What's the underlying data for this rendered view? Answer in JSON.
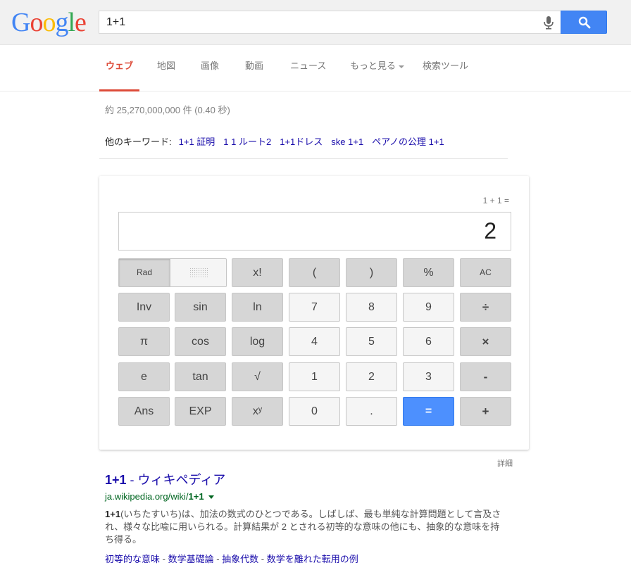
{
  "logo": {
    "letters": [
      "G",
      "o",
      "o",
      "g",
      "l",
      "e"
    ],
    "colors": [
      "#4285f4",
      "#ea4335",
      "#fbbc05",
      "#4285f4",
      "#34a853",
      "#ea4335"
    ]
  },
  "search": {
    "query": "1+1",
    "mic_icon": "microphone-icon",
    "button_icon": "search-icon"
  },
  "nav": {
    "tabs": [
      "ウェブ",
      "地図",
      "画像",
      "動画",
      "ニュース",
      "もっと見る",
      "検索ツール"
    ],
    "active_index": 0
  },
  "result_stats": "約 25,270,000,000 件 (0.40 秒)",
  "related": {
    "label": "他のキーワード:",
    "links": [
      "1+1 証明",
      "1 1 ルート2",
      "1+1ドレス",
      "ske 1+1",
      "ペアノの公理 1+1"
    ]
  },
  "calculator": {
    "expression": "1 + 1 =",
    "result": "2",
    "rad_label": "Rad",
    "keys": {
      "fact": "x!",
      "lparen": "(",
      "rparen": ")",
      "percent": "%",
      "ac": "AC",
      "inv": "Inv",
      "sin": "sin",
      "ln": "ln",
      "n7": "7",
      "n8": "8",
      "n9": "9",
      "divide": "÷",
      "pi": "π",
      "cos": "cos",
      "log": "log",
      "n4": "4",
      "n5": "5",
      "n6": "6",
      "multiply": "×",
      "e": "e",
      "tan": "tan",
      "sqrt": "√",
      "n1": "1",
      "n2": "2",
      "n3": "3",
      "minus": "-",
      "ans": "Ans",
      "exp": "EXP",
      "pow": "xʸ",
      "n0": "0",
      "dot": ".",
      "equals": "=",
      "plus": "+"
    },
    "details_label": "詳細"
  },
  "result": {
    "title_bold": "1+1",
    "title_rest": " - ウィキペディア",
    "url_prefix": "ja.wikipedia.org/wiki/",
    "url_bold": "1+1",
    "snippet_bold": "1+1",
    "snippet_rest": "(いちたすいち)は、加法の数式のひとつである。しばしば、最も単純な計算問題として言及され、様々な比喩に用いられる。計算結果が 2 とされる初等的な意味の他にも、抽象的な意味を持ち得る。",
    "sitelinks": [
      "初等的な意味",
      "数学基礎論",
      "抽象代数",
      "数学を離れた転用の例"
    ],
    "sitelink_separator": " - "
  }
}
